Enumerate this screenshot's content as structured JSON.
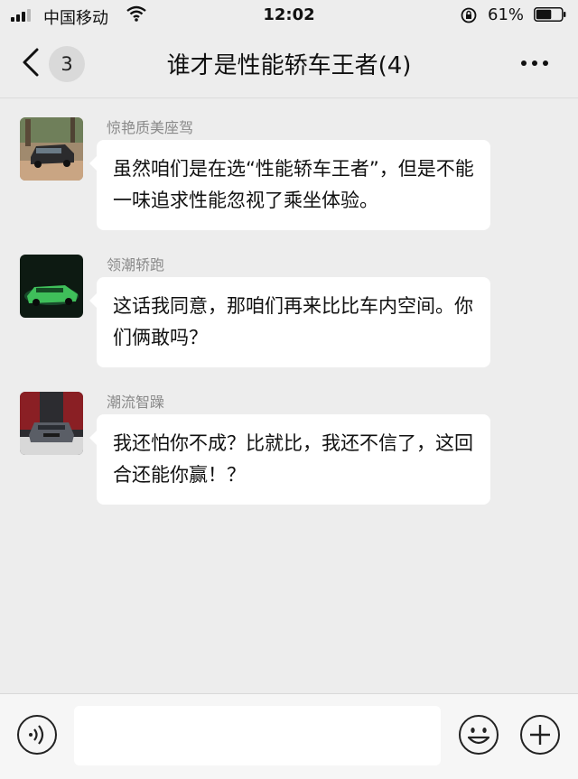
{
  "status_bar": {
    "carrier": "中国移动",
    "time": "12:02",
    "battery_percent": "61%",
    "battery_level": 0.61,
    "icons": [
      "signal-icon",
      "wifi-icon",
      "orientation-lock-icon",
      "battery-icon"
    ]
  },
  "nav": {
    "unread_count": "3",
    "title": "谁才是性能轿车王者(4)",
    "icons": [
      "back-icon",
      "more-icon"
    ]
  },
  "messages": [
    {
      "sender": "惊艳质美座驾",
      "text": "虽然咱们是在选“性能轿车王者”，但是不能一味追求性能忽视了乘坐体验。"
    },
    {
      "sender": "领潮轿跑",
      "text": "这话我同意，那咱们再来比比车内空间。你们俩敢吗？"
    },
    {
      "sender": "潮流智躁",
      "text": "我还怕你不成？比就比，我还不信了，这回合还能你赢！？"
    }
  ],
  "input_bar": {
    "text_value": "",
    "icons": [
      "voice-icon",
      "emoji-icon",
      "plus-icon"
    ]
  },
  "colors": {
    "background": "#ededed",
    "bubble": "#ffffff",
    "sender_name": "#8a8a8a",
    "input_bar": "#f6f6f6"
  }
}
